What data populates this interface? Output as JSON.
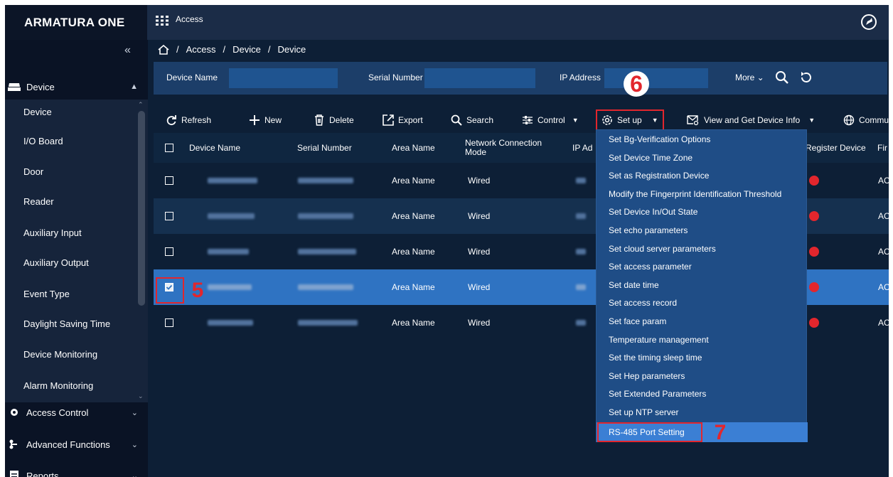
{
  "app": {
    "logo": "ARMATURA ONE",
    "title": "Access"
  },
  "sidebar": {
    "collapse_label": "«",
    "device_group": "Device",
    "items": [
      "Device",
      "I/O Board",
      "Door",
      "Reader",
      "Auxiliary Input",
      "Auxiliary Output",
      "Event Type",
      "Daylight Saving Time",
      "Device Monitoring",
      "Alarm Monitoring"
    ],
    "groups": [
      "Access Control",
      "Advanced Functions",
      "Reports"
    ]
  },
  "breadcrumb": [
    "Access",
    "Device",
    "Device"
  ],
  "filters": {
    "device_name_label": "Device Name",
    "serial_number_label": "Serial Number",
    "ip_address_label": "IP Address",
    "more_label": "More"
  },
  "toolbar": {
    "refresh": "Refresh",
    "new": "New",
    "delete": "Delete",
    "export": "Export",
    "search": "Search",
    "control": "Control",
    "setup": "Set up",
    "view_info": "View and Get Device Info",
    "communication": "Communi"
  },
  "table": {
    "headers": [
      "Device Name",
      "Serial Number",
      "Area Name",
      "Network Connection Mode",
      "IP Ad",
      "Register Device",
      "Fir"
    ],
    "rows": [
      {
        "area": "Area Name",
        "mode": "Wired",
        "fw": "AC",
        "checked": false
      },
      {
        "area": "Area Name",
        "mode": "Wired",
        "fw": "AC",
        "checked": false
      },
      {
        "area": "Area Name",
        "mode": "Wired",
        "fw": "AC",
        "checked": false
      },
      {
        "area": "Area Name",
        "mode": "Wired",
        "fw": "AC",
        "checked": true
      },
      {
        "area": "Area Name",
        "mode": "Wired",
        "fw": "AC",
        "checked": false
      }
    ]
  },
  "setup_menu": [
    "Set Bg-Verification Options",
    "Set Device Time Zone",
    "Set as Registration Device",
    "Modify the Fingerprint Identification Threshold",
    "Set Device In/Out State",
    "Set echo parameters",
    "Set cloud server parameters",
    "Set access parameter",
    "Set date time",
    "Set access record",
    "Set face param",
    "Temperature management",
    "Set the timing sleep time",
    "Set Hep parameters",
    "Set Extended Parameters",
    "Set up NTP server",
    "RS-485 Port Setting"
  ],
  "callouts": {
    "step5": "5",
    "step6": "6",
    "step7": "7"
  },
  "colors": {
    "accent": "#e2262d",
    "selected_row": "#2f73c2",
    "header": "#1b2c47",
    "menu": "#1f4d86"
  }
}
